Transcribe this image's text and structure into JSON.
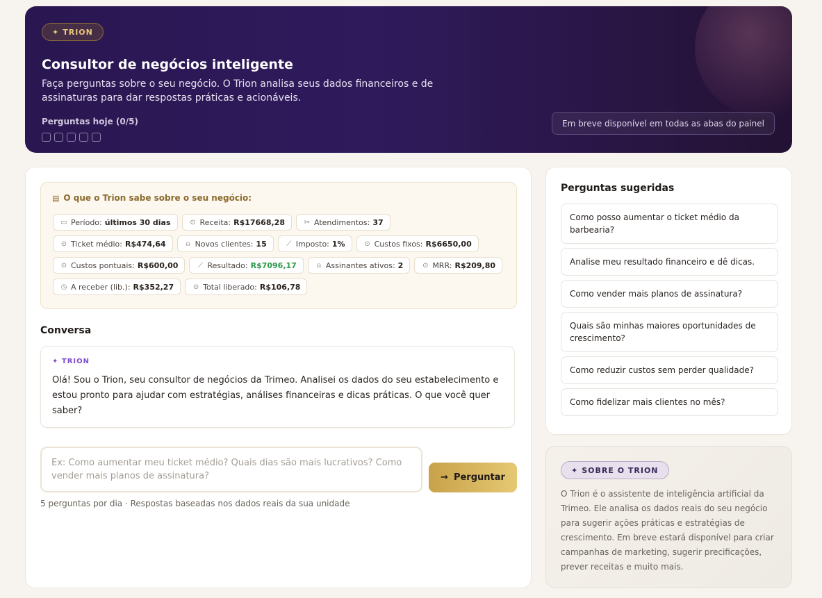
{
  "hero": {
    "badge": "TRION",
    "title": "Consultor de negócios inteligente",
    "description": "Faça perguntas sobre o seu negócio. O Trion analisa seus dados financeiros e de assinaturas para dar respostas práticas e acionáveis.",
    "questions_today": "Perguntas hoje (0/5)",
    "coming_soon": "Em breve disponível em todas as abas do painel"
  },
  "knowledge": {
    "title": "O que o Trion sabe sobre o seu negócio:",
    "chips": [
      {
        "icon": "calendar-icon",
        "glyph": "▭",
        "label": "Período:",
        "value": "últimos 30 dias"
      },
      {
        "icon": "coin-icon",
        "glyph": "⊙",
        "label": "Receita:",
        "value": "R$17668,28"
      },
      {
        "icon": "scissors-icon",
        "glyph": "✂",
        "label": "Atendimentos:",
        "value": "37"
      },
      {
        "icon": "coin-icon",
        "glyph": "⊙",
        "label": "Ticket médio:",
        "value": "R$474,64"
      },
      {
        "icon": "user-icon",
        "glyph": "⍝",
        "label": "Novos clientes:",
        "value": "15"
      },
      {
        "icon": "chart-icon",
        "glyph": "⟋",
        "label": "Imposto:",
        "value": "1%"
      },
      {
        "icon": "coin-icon",
        "glyph": "⊙",
        "label": "Custos fixos:",
        "value": "R$6650,00"
      },
      {
        "icon": "coin-icon",
        "glyph": "⊙",
        "label": "Custos pontuais:",
        "value": "R$600,00"
      },
      {
        "icon": "chart-icon",
        "glyph": "⟋",
        "label": "Resultado:",
        "value": "R$7096,17",
        "positive": true
      },
      {
        "icon": "user-icon",
        "glyph": "⍝",
        "label": "Assinantes ativos:",
        "value": "2"
      },
      {
        "icon": "coin-icon",
        "glyph": "⊙",
        "label": "MRR:",
        "value": "R$209,80"
      },
      {
        "icon": "clock-icon",
        "glyph": "◷",
        "label": "A receber (lib.):",
        "value": "R$352,27"
      },
      {
        "icon": "coin-icon",
        "glyph": "⊙",
        "label": "Total liberado:",
        "value": "R$106,78"
      }
    ]
  },
  "conversation": {
    "title": "Conversa",
    "message_sender": "TRION",
    "message_text": "Olá! Sou o Trion, seu consultor de negócios da Trimeo. Analisei os dados do seu estabelecimento e estou pronto para ajudar com estratégias, análises financeiras e dicas práticas. O que você quer saber?"
  },
  "ask": {
    "placeholder": "Ex: Como aumentar meu ticket médio? Quais dias são mais lucrativos? Como vender mais planos de assinatura?",
    "value": "",
    "button_label": "Perguntar",
    "note": "5 perguntas por dia · Respostas baseadas nos dados reais da sua unidade"
  },
  "suggestions": {
    "title": "Perguntas sugeridas",
    "items": [
      "Como posso aumentar o ticket médio da barbearia?",
      "Analise meu resultado financeiro e dê dicas.",
      "Como vender mais planos de assinatura?",
      "Quais são minhas maiores oportunidades de crescimento?",
      "Como reduzir custos sem perder qualidade?",
      "Como fidelizar mais clientes no mês?"
    ]
  },
  "about": {
    "badge": "SOBRE O TRION",
    "text": "O Trion é o assistente de inteligência artificial da Trimeo. Ele analisa os dados reais do seu negócio para sugerir ações práticas e estratégias de crescimento. Em breve estará disponível para criar campanhas de marketing, sugerir precificações, prever receitas e muito mais."
  },
  "colors": {
    "accent_gold": "#c8a24a",
    "hero_purple": "#2f1b5c",
    "positive_green": "#2d9a4a",
    "trion_purple": "#7b4bd0"
  }
}
